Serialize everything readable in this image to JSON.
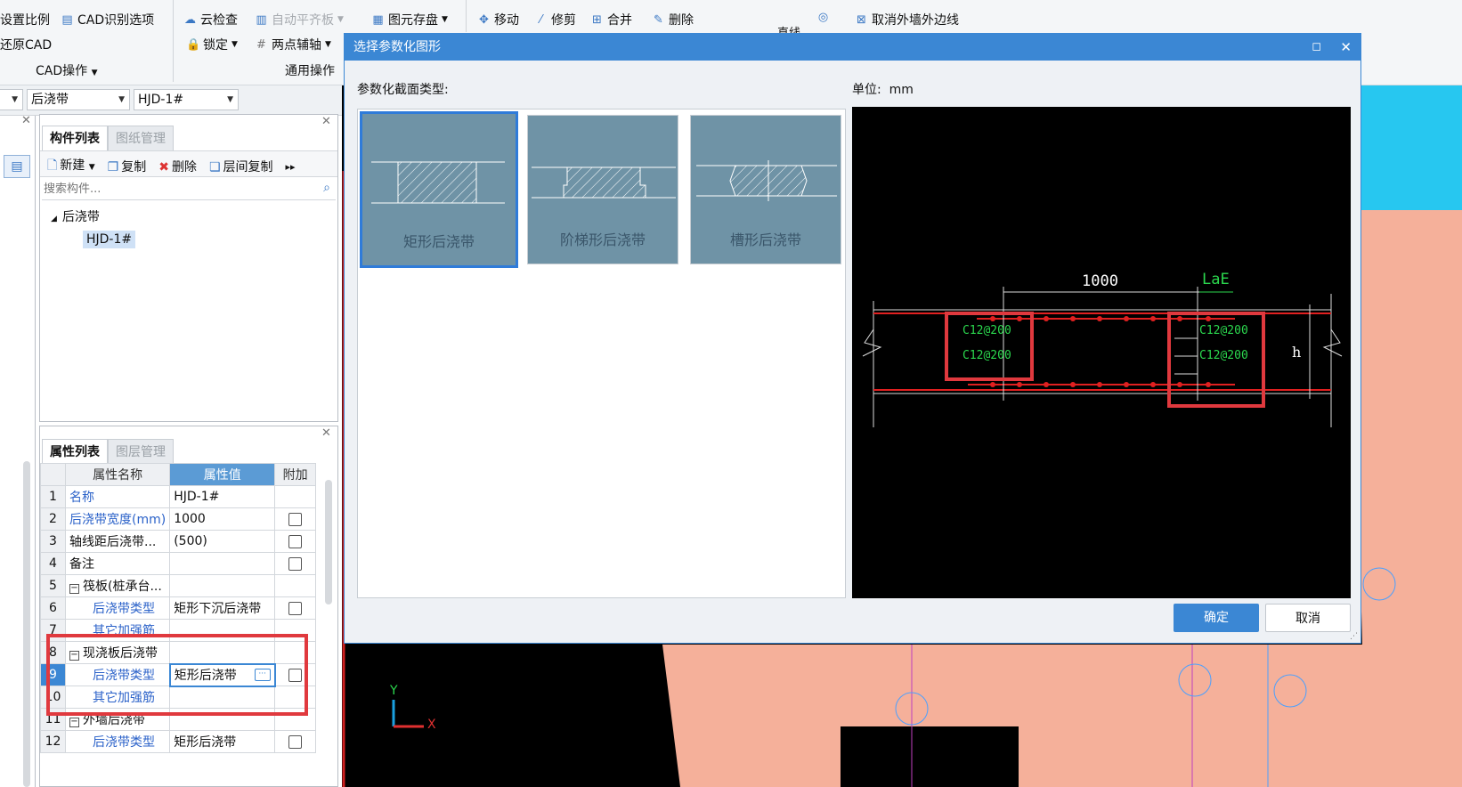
{
  "ribbon": {
    "set_scale": "设置比例",
    "cad_recog": "CAD识别选项",
    "restore_cad": "还原CAD",
    "cad_ops": "CAD操作",
    "cloud_check": "云检查",
    "auto_align": "自动平齐板",
    "save_elements": "图元存盘",
    "lock": "锁定",
    "two_point_axis": "两点辅轴",
    "general_ops": "通用操作",
    "move": "移动",
    "trim": "修剪",
    "merge": "合并",
    "delete": "删除",
    "line": "直线",
    "cancel_outer_edge": "取消外墙外边线"
  },
  "selectors": {
    "type_value": "后浇带",
    "name_value": "HJD-1#"
  },
  "component_panel": {
    "tabs": [
      "构件列表",
      "图纸管理"
    ],
    "toolbar": {
      "new": "新建",
      "copy": "复制",
      "delete": "删除",
      "floor_copy": "层间复制"
    },
    "search_placeholder": "搜索构件...",
    "tree_root": "后浇带",
    "tree_child": "HJD-1#"
  },
  "property_panel": {
    "tabs": [
      "属性列表",
      "图层管理"
    ],
    "headers": [
      "属性名称",
      "属性值",
      "附加"
    ],
    "rows": [
      {
        "n": "1",
        "name": "名称",
        "value": "HJD-1#"
      },
      {
        "n": "2",
        "name": "后浇带宽度(mm)",
        "value": "1000"
      },
      {
        "n": "3",
        "name": "轴线距后浇带...",
        "value": "(500)"
      },
      {
        "n": "4",
        "name": "备注",
        "value": ""
      },
      {
        "n": "5",
        "name": "筏板(桩承台...",
        "value": ""
      },
      {
        "n": "6",
        "name": "后浇带类型",
        "value": "矩形下沉后浇带"
      },
      {
        "n": "7",
        "name": "其它加强筋",
        "value": ""
      },
      {
        "n": "8",
        "name": "现浇板后浇带",
        "value": ""
      },
      {
        "n": "9",
        "name": "后浇带类型",
        "value": "矩形后浇带"
      },
      {
        "n": "10",
        "name": "其它加强筋",
        "value": ""
      },
      {
        "n": "11",
        "name": "外墙后浇带",
        "value": ""
      },
      {
        "n": "12",
        "name": "后浇带类型",
        "value": "矩形后浇带"
      }
    ]
  },
  "dialog": {
    "title": "选择参数化图形",
    "section_label": "参数化截面类型:",
    "unit_label": "单位:",
    "unit_value": "mm",
    "options": [
      "矩形后浇带",
      "阶梯形后浇带",
      "槽形后浇带"
    ],
    "ok": "确定",
    "cancel": "取消"
  },
  "preview": {
    "width_dim": "1000",
    "lae_dim": "LaE",
    "height_dim": "h",
    "rebar_left_top": "C12@200",
    "rebar_left_bottom": "C12@200",
    "rebar_right_top": "C12@200",
    "rebar_right_bottom": "C12@200"
  },
  "cad_axes": {
    "y": "Y",
    "x": "X"
  },
  "colors": {
    "accent": "#3b87d4",
    "highlight_red": "#e0393e",
    "cad_bg": "#000000",
    "cad_fill": "#f5b09a",
    "cad_cyan": "#27c7f0"
  }
}
